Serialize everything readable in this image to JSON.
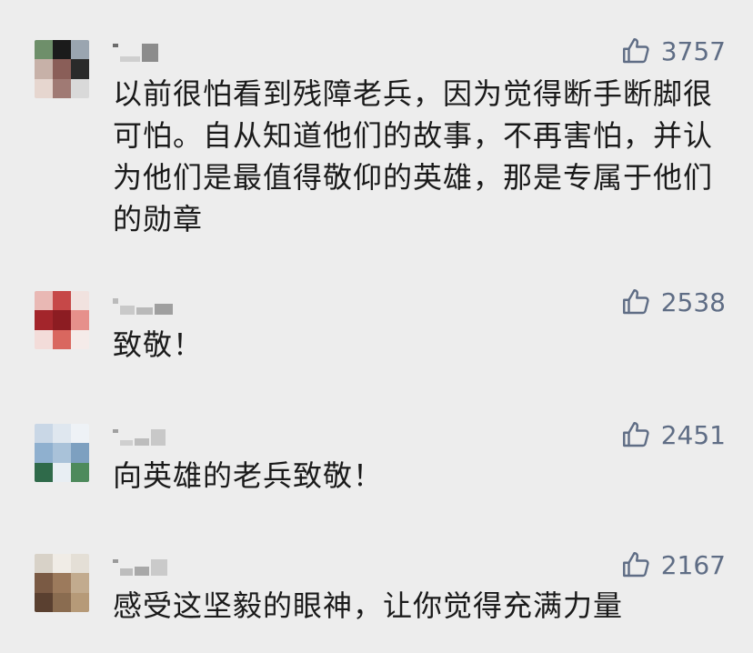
{
  "comments": [
    {
      "likes": "3757",
      "text": "以前很怕看到残障老兵，因为觉得断手断脚很可怕。自从知道他们的故事，不再害怕，并认为他们是最值得敬仰的英雄，那是专属于他们的勋章"
    },
    {
      "likes": "2538",
      "text": "致敬！"
    },
    {
      "likes": "2451",
      "text": "向英雄的老兵致敬！"
    },
    {
      "likes": "2167",
      "text": "感受这坚毅的眼神，让你觉得充满力量"
    }
  ],
  "icons": {
    "like": "thumbs-up-icon",
    "avatar": "blurred-avatar",
    "nickname": "blurred-nickname"
  },
  "colors": {
    "background": "#ededed",
    "like_text": "#5f6d85",
    "comment_text": "#1a1a1a"
  }
}
